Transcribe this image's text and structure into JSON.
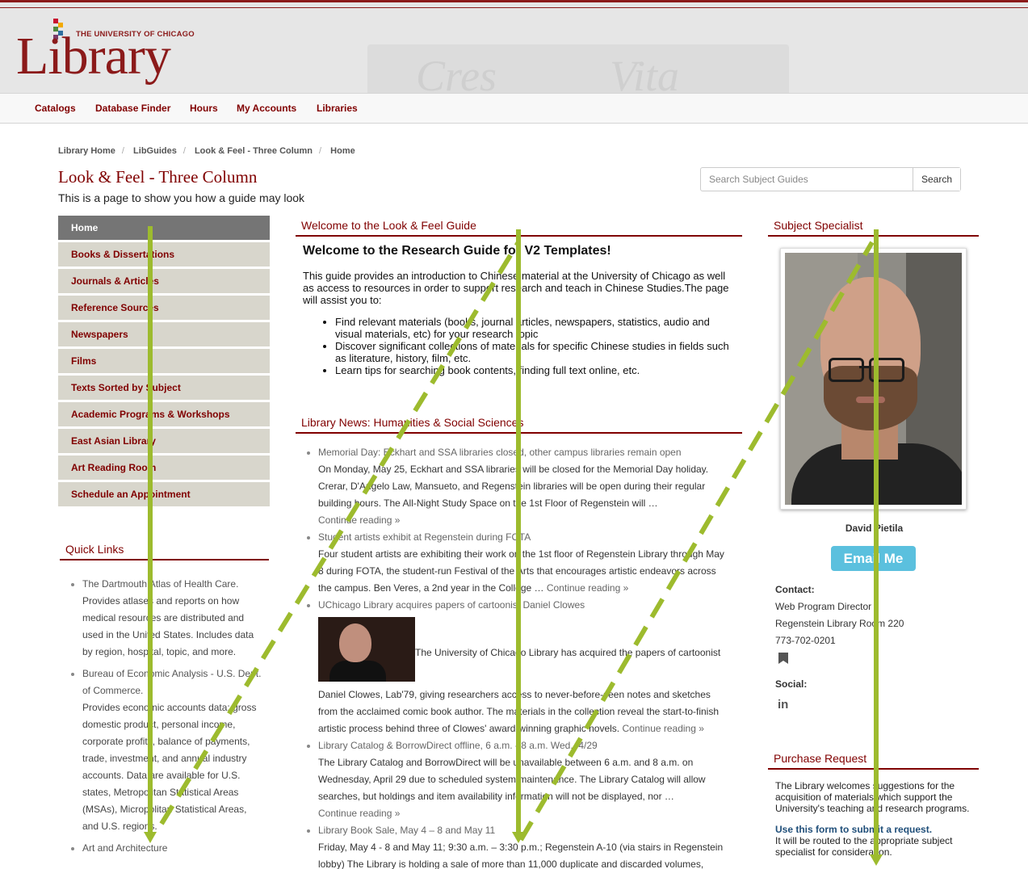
{
  "header": {
    "logo_small": "THE UNIVERSITY OF CHICAGO",
    "logo_big": "Library",
    "crest_left": "Cres",
    "crest_right": "Vita"
  },
  "nav": [
    "Catalogs",
    "Database Finder",
    "Hours",
    "My Accounts",
    "Libraries"
  ],
  "breadcrumb": [
    "Library Home",
    "LibGuides",
    "Look & Feel - Three Column",
    "Home"
  ],
  "page": {
    "title": "Look & Feel - Three Column",
    "subtitle": "This is a page to show you how a guide may look"
  },
  "search": {
    "placeholder": "Search Subject Guides",
    "button": "Search"
  },
  "leftnav": [
    "Home",
    "Books & Dissertations",
    "Journals & Articles",
    "Reference Sources",
    "Newspapers",
    "Films",
    "Texts Sorted by Subject",
    "Academic Programs & Workshops",
    "East Asian Library",
    "Art Reading Room",
    "Schedule an Appointment"
  ],
  "quick_links": {
    "heading": "Quick Links",
    "items": [
      {
        "title": "The Dartmouth Atlas of Health Care.",
        "desc": "Provides atlases and reports on how medical resources are distributed and used in the United States. Includes data by region, hospital, topic, and more."
      },
      {
        "title": "Bureau of Economic Analysis - U.S. Dept. of Commerce.",
        "desc": "Provides economic accounts data: gross domestic product, personal income, corporate profits, balance of payments, trade, investment, and annual industry accounts. Data are available for U.S. states, Metropolitan Statistical Areas (MSAs), Micropolitan Statistical Areas, and U.S. regions."
      },
      {
        "title": "Art and Architecture",
        "desc": ""
      }
    ]
  },
  "welcome": {
    "heading": "Welcome to the Look & Feel Guide",
    "title": "Welcome to the Research Guide for V2 Templates!",
    "intro": "This guide provides an introduction to Chinese material at the University of Chicago as well as access to resources in order to support research and teach in Chinese Studies.The page will assist you to:",
    "bullets": [
      "Find relevant materials (books, journal articles, newspapers, statistics, audio and visual materials, etc) for your research topic",
      "Discover significant collections of materials for specific Chinese studies in fields such as literature, history, film, etc.",
      "Learn tips for searching book contents, finding full text online, etc."
    ]
  },
  "news": {
    "heading": "Library News: Humanities & Social Sciences",
    "items": [
      {
        "title": "Memorial Day: Eckhart and SSA libraries closed, other campus libraries remain open",
        "body": "On Monday, May 25, Eckhart and SSA libraries will be closed for the Memorial Day holiday. Crerar, D'Angelo Law, Mansueto, and Regenstein libraries will be open during their regular building hours. The All-Night Study Space on the 1st Floor of Regenstein will …",
        "more": "Continue reading »"
      },
      {
        "title": "Student artists exhibit at Regenstein during FOTA",
        "body": "Four student artists are exhibiting their work on the 1st floor of Regenstein Library through May 8 during FOTA, the student-run Festival of the Arts that encourages artistic endeavors across the campus.  Ben Veres, a 2nd year in the College …",
        "more": "Continue reading »"
      },
      {
        "title": "UChicago Library acquires papers of cartoonist Daniel Clowes",
        "caption": "The University of Chicago Library has acquired the papers of cartoonist",
        "body": "Daniel Clowes, Lab'79, giving researchers access to never-before-seen notes and sketches from the acclaimed comic book author. The materials in the collection reveal the start-to-finish artistic process behind three of Clowes' award-winning graphic novels.",
        "more": "Continue reading »"
      },
      {
        "title": "Library Catalog & BorrowDirect offline, 6 a.m. - 8 a.m. Wed., 4/29",
        "body": "The Library Catalog and BorrowDirect will be unavailable between 6 a.m. and 8 a.m. on Wednesday, April 29 due to scheduled system maintenance. The Library Catalog will allow searches, but holdings and item availability information will not be displayed, nor …",
        "more": "Continue reading »"
      },
      {
        "title": "Library Book Sale, May 4 – 8 and May 11",
        "body": "Friday, May 4 - 8 and May 11; 9:30 a.m. – 3:30 p.m.; Regenstein A-10 (via stairs in Regenstein lobby) The Library is holding a sale of more than 11,000 duplicate and discarded volumes,",
        "more": ""
      }
    ]
  },
  "specialist": {
    "heading": "Subject Specialist",
    "name": "David Pietila",
    "email_button": "Email Me",
    "contact_label": "Contact:",
    "contact_lines": [
      "Web Program Director",
      "Regenstein Library Room 220",
      "773-702-0201"
    ],
    "social_label": "Social:",
    "social_icon": "in"
  },
  "purchase": {
    "heading": "Purchase Request",
    "body": "The Library welcomes suggestions for the acquisition of materials which support the University's teaching and research programs.",
    "link": "Use this form to submit a request.",
    "note": "It will be routed to the appropriate subject specialist for consideration."
  },
  "colors": {
    "brand": "#800000",
    "overlay": "#9dbb2e",
    "email_button": "#5bc0de",
    "active_nav": "#757575",
    "nav_item_bg": "#d8d6cc"
  }
}
